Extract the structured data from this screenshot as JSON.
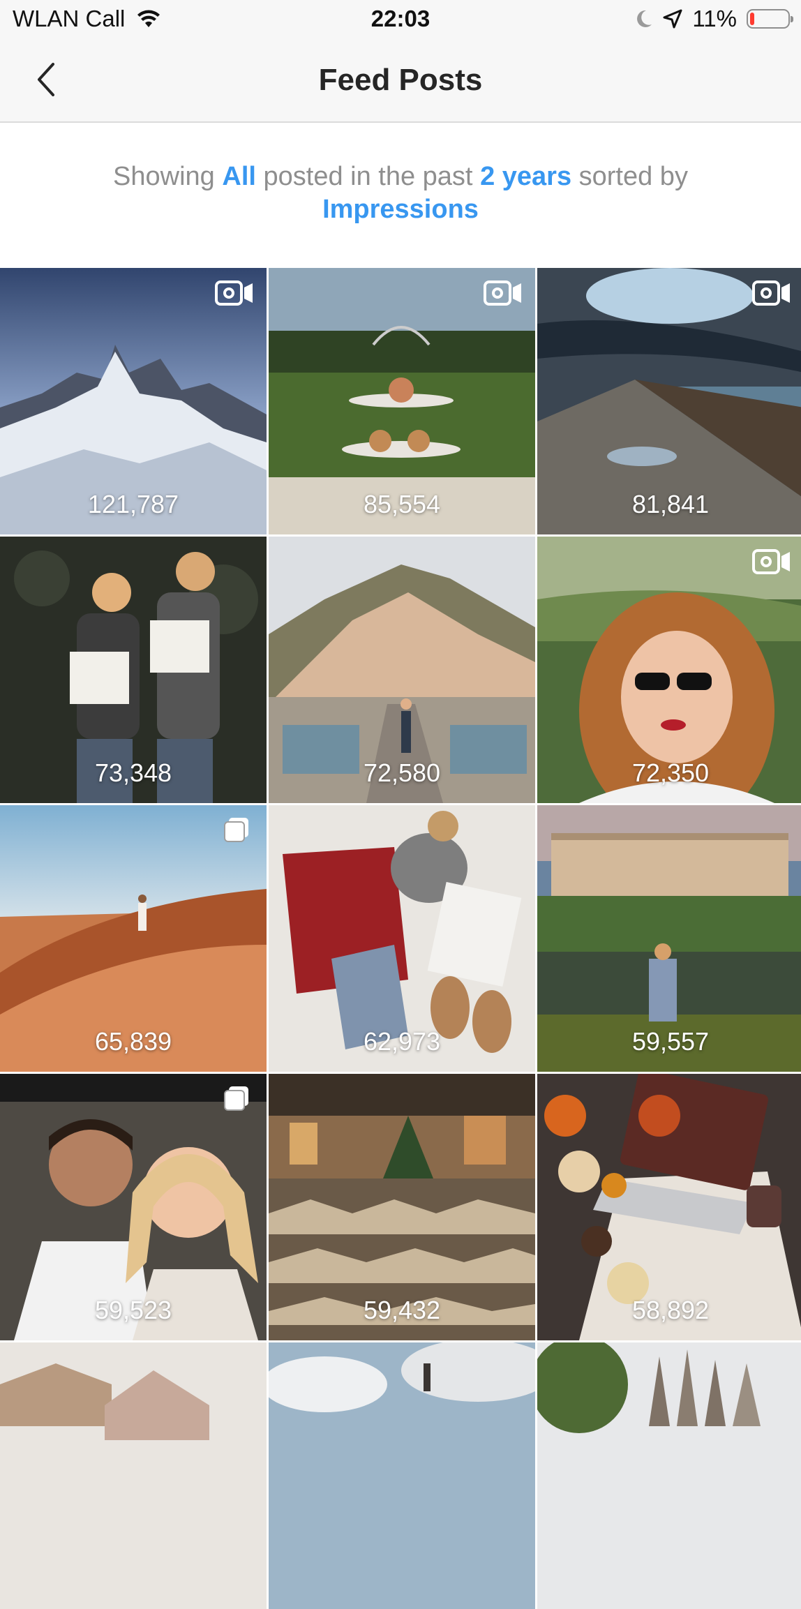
{
  "status_bar": {
    "carrier": "WLAN Call",
    "time": "22:03",
    "battery_percent": "11%",
    "battery_level": 0.11,
    "icons": [
      "wifi-icon",
      "moon-icon",
      "location-arrow-icon",
      "battery-icon"
    ]
  },
  "nav": {
    "title": "Feed Posts",
    "back_icon": "chevron-left-icon"
  },
  "filter": {
    "prefix": "Showing",
    "type": "All",
    "middle": "posted in the past",
    "period": "2 years",
    "suffix": "sorted by",
    "sort": "Impressions"
  },
  "posts": [
    {
      "count": "121,787",
      "media_type": "video"
    },
    {
      "count": "85,554",
      "media_type": "video"
    },
    {
      "count": "81,841",
      "media_type": "video"
    },
    {
      "count": "73,348",
      "media_type": "photo"
    },
    {
      "count": "72,580",
      "media_type": "photo"
    },
    {
      "count": "72,350",
      "media_type": "video"
    },
    {
      "count": "65,839",
      "media_type": "carousel"
    },
    {
      "count": "62,973",
      "media_type": "photo"
    },
    {
      "count": "59,557",
      "media_type": "photo"
    },
    {
      "count": "59,523",
      "media_type": "carousel"
    },
    {
      "count": "59,432",
      "media_type": "photo"
    },
    {
      "count": "58,892",
      "media_type": "photo"
    },
    {
      "count": "",
      "media_type": "photo"
    },
    {
      "count": "",
      "media_type": "photo"
    },
    {
      "count": "",
      "media_type": "photo"
    }
  ]
}
